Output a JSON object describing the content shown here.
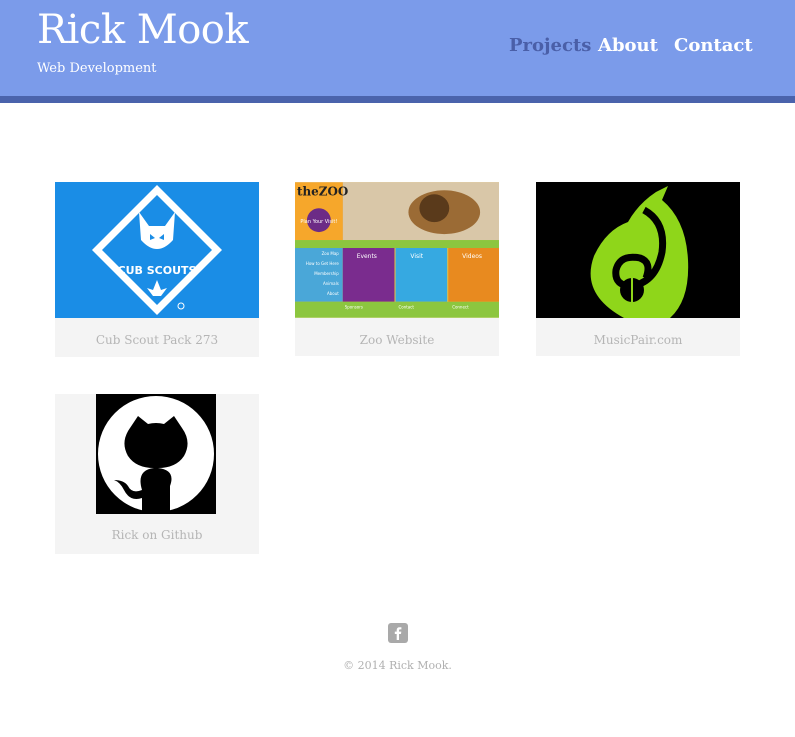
{
  "site": {
    "title": "Rick Mook",
    "tagline": "Web Development"
  },
  "nav": {
    "projects": "Projects",
    "about": "About",
    "contact": "Contact"
  },
  "projects": [
    {
      "caption": "Cub Scout Pack 273",
      "logo_text": "CUB SCOUTS",
      "image": "cub-scouts-logo"
    },
    {
      "caption": "Zoo Website",
      "image": "zoo-website-screenshot",
      "zoo": {
        "brand": "theZOO",
        "badge": "Plan Your Visit!",
        "menu": [
          "Zoo Map",
          "How to Get Here",
          "Membership",
          "Animals",
          "About"
        ],
        "tiles": [
          "Events",
          "Visit",
          "Videos"
        ],
        "footer": [
          "Sponsors",
          "Contact",
          "Connect"
        ]
      }
    },
    {
      "caption": "MusicPair.com",
      "image": "musicpair-pear-logo"
    },
    {
      "caption": "Rick on Github",
      "image": "github-octocat-logo"
    }
  ],
  "footer": {
    "copyright": "© 2014 Rick Mook.",
    "social_icon": "facebook-icon"
  },
  "colors": {
    "header": "#7b9bea",
    "header_bar": "#4a63ac",
    "nav_active": "#4a5fa8",
    "scouts_blue": "#1a8de6",
    "pear_green": "#8fd61a"
  }
}
